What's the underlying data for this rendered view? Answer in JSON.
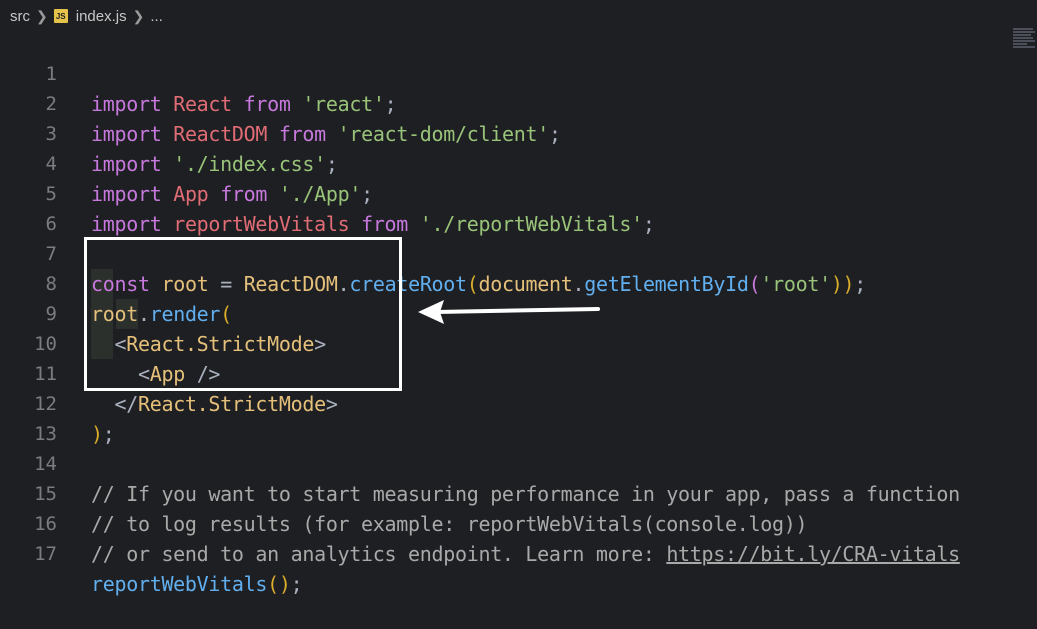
{
  "breadcrumb": {
    "folder": "src",
    "file": "index.js",
    "more": "...",
    "file_icon": "JS"
  },
  "lines": [
    {
      "n": "1"
    },
    {
      "n": "2"
    },
    {
      "n": "3"
    },
    {
      "n": "4"
    },
    {
      "n": "5"
    },
    {
      "n": "6"
    },
    {
      "n": "7"
    },
    {
      "n": "8"
    },
    {
      "n": "9"
    },
    {
      "n": "10"
    },
    {
      "n": "11"
    },
    {
      "n": "12"
    },
    {
      "n": "13"
    },
    {
      "n": "14"
    },
    {
      "n": "15"
    },
    {
      "n": "16"
    },
    {
      "n": "17"
    }
  ],
  "code": {
    "l1": {
      "a": "import",
      "b": "React",
      "c": "from",
      "d": "'react'",
      "e": ";"
    },
    "l2": {
      "a": "import",
      "b": "ReactDOM",
      "c": "from",
      "d": "'react-dom/client'",
      "e": ";"
    },
    "l3": {
      "a": "import",
      "d": "'./index.css'",
      "e": ";"
    },
    "l4": {
      "a": "import",
      "b": "App",
      "c": "from",
      "d": "'./App'",
      "e": ";"
    },
    "l5": {
      "a": "import",
      "b": "reportWebVitals",
      "c": "from",
      "d": "'./reportWebVitals'",
      "e": ";"
    },
    "l7": {
      "kw": "const",
      "v": "root",
      "eq": "=",
      "obj": "ReactDOM",
      "dot": ".",
      "fn": "createRoot",
      "p1": "(",
      "obj2": "document",
      "dot2": ".",
      "fn2": "getElementById",
      "p2": "(",
      "s": "'root'",
      "p3": "))",
      "semi": ";"
    },
    "l8": {
      "obj": "root",
      "dot": ".",
      "fn": "render",
      "p": "("
    },
    "l9": {
      "lt": "<",
      "tag": "React.StrictMode",
      "gt": ">"
    },
    "l10": {
      "lt": "<",
      "tag": "App",
      "gt": " />"
    },
    "l11": {
      "lt": "</",
      "tag": "React.StrictMode",
      "gt": ">"
    },
    "l12": {
      "p": ")",
      "semi": ";"
    },
    "l14": "// If you want to start measuring performance in your app, pass a function",
    "l15": "// to log results (for example: reportWebVitals(console.log))",
    "l16": {
      "text": "// or send to an analytics endpoint. Learn more: ",
      "url": "https://bit.ly/CRA-vitals"
    },
    "l17": {
      "fn": "reportWebVitals",
      "p": "()",
      "semi": ";"
    }
  },
  "colors": {
    "keyword": "#c678dd",
    "identifier": "#e06c75",
    "string": "#98c379",
    "function": "#61afef",
    "variable": "#e5c07b",
    "comment": "#a9a9a9",
    "background": "#1e1f22"
  }
}
